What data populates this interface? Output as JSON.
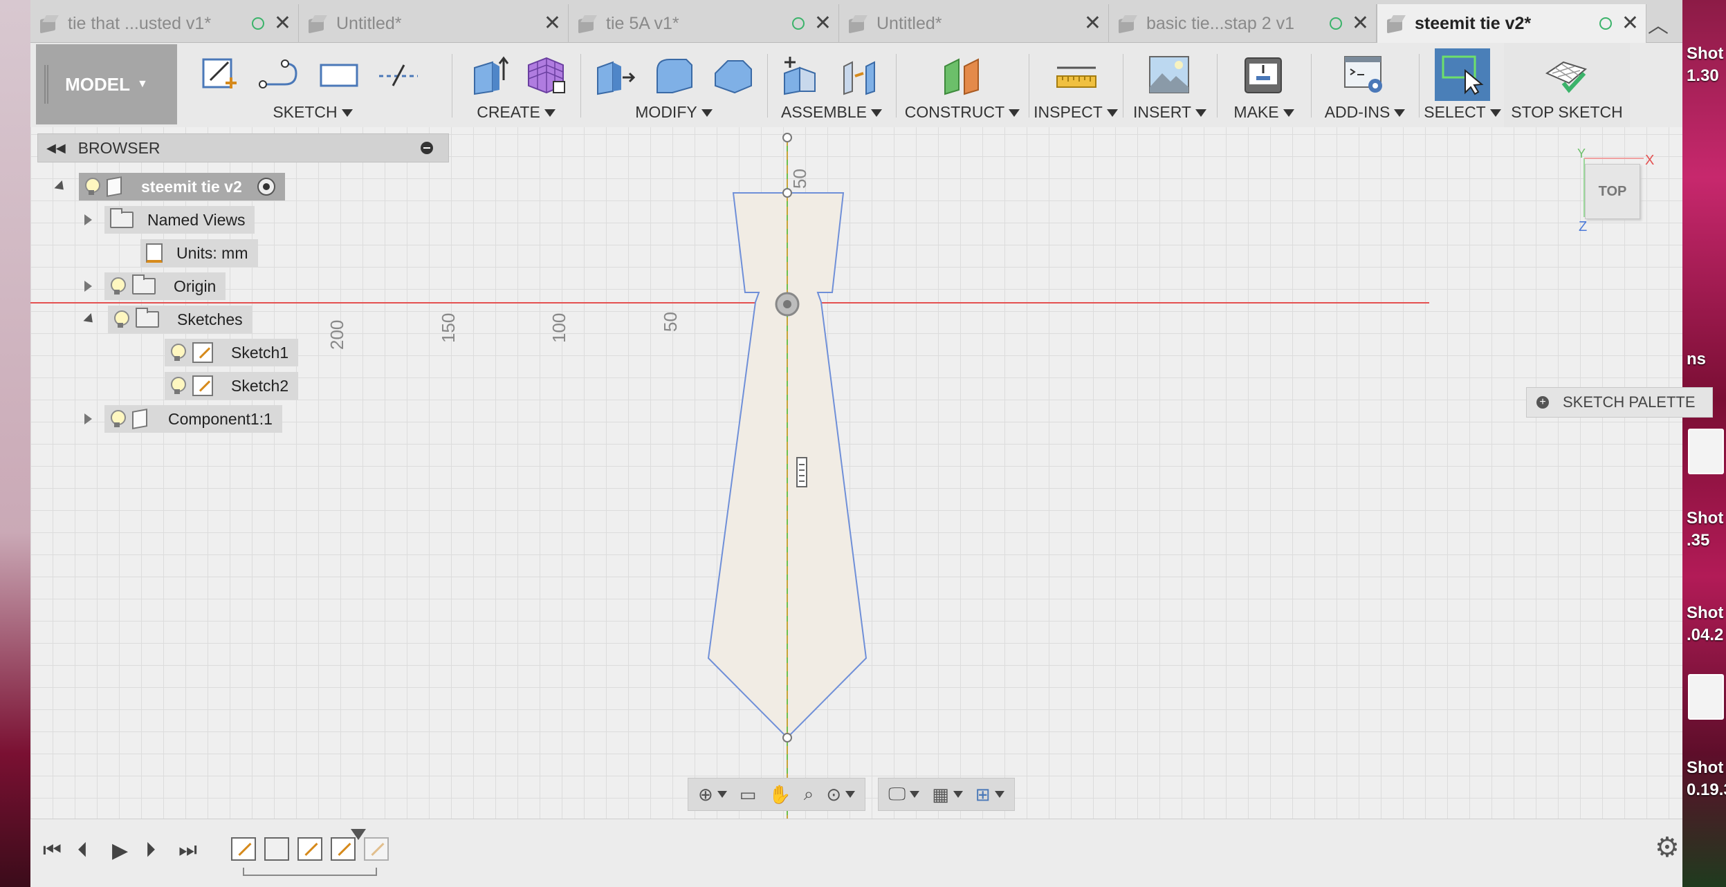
{
  "tabs": [
    {
      "label": "tie that ...usted v1*",
      "dot": true,
      "active": false
    },
    {
      "label": "Untitled*",
      "dot": false,
      "active": false
    },
    {
      "label": "tie 5A v1*",
      "dot": true,
      "active": false
    },
    {
      "label": "Untitled*",
      "dot": false,
      "active": false
    },
    {
      "label": "basic tie...stap 2 v1",
      "dot": true,
      "active": false
    },
    {
      "label": "steemit tie v2*",
      "dot": true,
      "active": true
    }
  ],
  "toolbar": {
    "workspace": "MODEL",
    "groups": {
      "sketch": "SKETCH",
      "create": "CREATE",
      "modify": "MODIFY",
      "assemble": "ASSEMBLE",
      "construct": "CONSTRUCT",
      "inspect": "INSPECT",
      "insert": "INSERT",
      "make": "MAKE",
      "addins": "ADD-INS",
      "select": "SELECT",
      "stop_sketch": "STOP SKETCH"
    }
  },
  "browser": {
    "title": "BROWSER",
    "root": "steemit tie v2",
    "named_views": "Named Views",
    "units": "Units: mm",
    "origin": "Origin",
    "sketches": "Sketches",
    "sketch1": "Sketch1",
    "sketch2": "Sketch2",
    "component": "Component1:1"
  },
  "canvas": {
    "ruler_labels": {
      "h200": "200",
      "h150": "150",
      "h100": "100",
      "h50": "50",
      "v50": "50"
    },
    "viewcube": "TOP",
    "axis_x": "X",
    "axis_y": "Y",
    "axis_z": "Z"
  },
  "sketch_palette": "SKETCH PALETTE",
  "desktop": {
    "labels": [
      "Shot",
      "1.30",
      "ns",
      "Shot",
      ".35",
      "Shot",
      ".04.2",
      "Shot",
      "0.19.3"
    ]
  },
  "colors": {
    "sketch_profile": "#6f8fd8",
    "sketch_fill": "#f1ece4",
    "center_line": "#c8a438",
    "x_axis": "#e45050",
    "select_active": "#4a7fb8"
  }
}
